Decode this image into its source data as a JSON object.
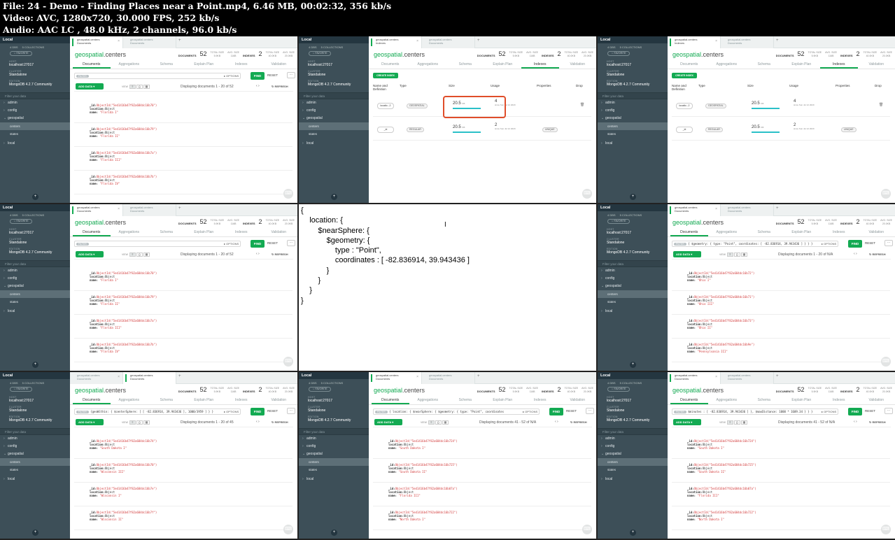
{
  "header": {
    "line1": "File: 24 - Demo - Finding Places near a Point.mp4, 6.46 MB, 00:02:32, 356 kb/s",
    "line2": "Video: AVC, 1280x720, 30.000 FPS, 252 kb/s",
    "line3": "Audio: AAC LC , 48.0 kHz, 2 channels, 96.0 kb/s"
  },
  "sidebar": {
    "title": "Local",
    "dbs_label": "4 DBS",
    "collections_label": "5 COLLECTIONS",
    "favorite": "☆ FAVORITE",
    "host_key": "HOST",
    "host": "localhost:27017",
    "cluster_key": "CLUSTER",
    "cluster": "Standalone",
    "edition_key": "EDITION",
    "edition": "MongoDB 4.2.7 Community",
    "filter": "Filter your data",
    "dbs": [
      "admin",
      "config",
      "geospatial"
    ],
    "collections": [
      "centers",
      "states"
    ],
    "last_db": "local"
  },
  "tabs": {
    "tab1_ns": "geospatial.centers",
    "tab2_ns": "geospatial.centers",
    "documents": "Documents",
    "indexes": "Indexes"
  },
  "ns": {
    "db": "geospatial",
    "coll": ".centers"
  },
  "stats": {
    "documents_label": "DOCUMENTS",
    "documents": "52",
    "total_size_label": "TOTAL SIZE",
    "total_size": "5.9KB",
    "avg_size_label": "AVG. SIZE",
    "avg_size": "116B",
    "indexes_label": "INDEXES",
    "indexes": "2",
    "idx_total_label": "TOTAL SIZE",
    "idx_total": "40.0KB",
    "idx_avg_label": "AVG. SIZE",
    "idx_avg": "20.0KB"
  },
  "subtabs": [
    "Documents",
    "Aggregations",
    "Schema",
    "Explain Plan",
    "Indexes",
    "Validation"
  ],
  "toolbar": {
    "filter_pill": "FILTER",
    "options": "▸ OPTIONS",
    "find": "FIND",
    "reset": "RESET",
    "more": "...",
    "add_data": "ADD DATA ▾",
    "view": "VIEW",
    "refresh": "↻ REFRESH",
    "nav": "‹  ›"
  },
  "queries": {
    "q5": "{ $geometry: { type: \"Point\", coordinates: [ -82.836914, 39.943436 ] } } }",
    "q6": "{geoWithin: { $centerSphere: [ [ -82.836914, 39.943436 ], 1000/3959 ] } }",
    "q7": "{ location: { $nearSphere: { $geometry: { type: \"Point\", coordinates",
    "q8": "$minutes : [ -82.836914, 39.943436 ] }, $maxDistance: 1000 * 1609.34 } } }"
  },
  "displaying": {
    "d1": "Displaying documents 1 - 20 of 52",
    "d5": "Displaying documents 1 - 20 of N/A",
    "d6": "Displaying documents 1 - 20 of 45",
    "d7": "Displaying documents 41 - 52 of N/A",
    "d8": "Displaying documents 41 - 52 of N/A"
  },
  "docsets": {
    "florida": [
      {
        "id": "ObjectId(\"5ed1416b47f82a684dc16b70\")",
        "name": "\"Florida I\""
      },
      {
        "id": "ObjectId(\"5ed1416b47f82a684dc16b79\")",
        "name": "\"Florida II\""
      },
      {
        "id": "ObjectId(\"5ed1416b47f82a684dc16b7a\")",
        "name": "\"Florida III\""
      },
      {
        "id": "ObjectId(\"5ed1416b47f82a684dc16b7b\")",
        "name": "\"Florida IV\""
      }
    ],
    "ohio": [
      {
        "id": "ObjectId(\"5ed1416b47f82a684dc16b72\")",
        "name": "\"Ohio I\""
      },
      {
        "id": "ObjectId(\"5ed1416b47f82a684dc16b71\")",
        "name": "\"Ohio III\""
      },
      {
        "id": "ObjectId(\"5ed1416b47f82a684dc16b73\")",
        "name": "\"Ohio II\""
      },
      {
        "id": "ObjectId(\"5ed1416b47f82a684dc16b9e\")",
        "name": "\"Pennsylvania III\""
      }
    ],
    "wisc": [
      {
        "id": "ObjectId(\"5ed1416b47f82a684dc16b74\")",
        "name": "\"South Dakota I\""
      },
      {
        "id": "ObjectId(\"5ed1416b47f82a684dc16b70\")",
        "name": "\"Wisconsin III\""
      },
      {
        "id": "ObjectId(\"5ed1416b47f82a684dc16b7e\")",
        "name": "\"Wisconsin I\""
      },
      {
        "id": "ObjectId(\"5ed1416b47f82a684dc16b7f\")",
        "name": "\"Wisconsin II\""
      }
    ],
    "sd": [
      {
        "id": "ObjectId(\"5ed1416b47f82a684dc16b724\")",
        "name": "\"South Dakota I\""
      },
      {
        "id": "ObjectId(\"5ed1416b47f82a684dc16b725\")",
        "name": "\"South Dakota II\""
      },
      {
        "id": "ObjectId(\"5ed1416b47f82a684dc16b07a\")",
        "name": "\"Florida III\""
      },
      {
        "id": "ObjectId(\"5ed1416b47f82a684dc16b722\")",
        "name": "\"North Dakota I\""
      }
    ]
  },
  "doc_keys": {
    "id": "_id:",
    "location": "location:",
    "location_val": "Object",
    "name": "name:"
  },
  "indexes_view": {
    "create": "CREATE INDEX",
    "hdr_name": "Name and Definition",
    "hdr_type": "Type",
    "hdr_size": "Size",
    "hdr_usage": "Usage",
    "hdr_props": "Properties",
    "hdr_drop": "Drop",
    "rows": [
      {
        "name": "locatio...2",
        "type": "GEOSPATIAL",
        "size": "20.5",
        "unit": "KB",
        "usage": "4",
        "since": "since Sun Jul 12 2020",
        "prop": ""
      },
      {
        "name": "_id",
        "type": "REGULAR",
        "size": "20.5",
        "unit": "KB",
        "usage": "2",
        "since": "since Sun Jul 12 2020",
        "prop": "UNIQUE"
      }
    ]
  },
  "code_text": "{\n    location: {\n        $nearSphere: {\n            $geometry: {\n                type : \"Point\",\n                coordinates : [ -82.836914, 39.943436 ]\n            }\n        }\n    }\n}"
}
